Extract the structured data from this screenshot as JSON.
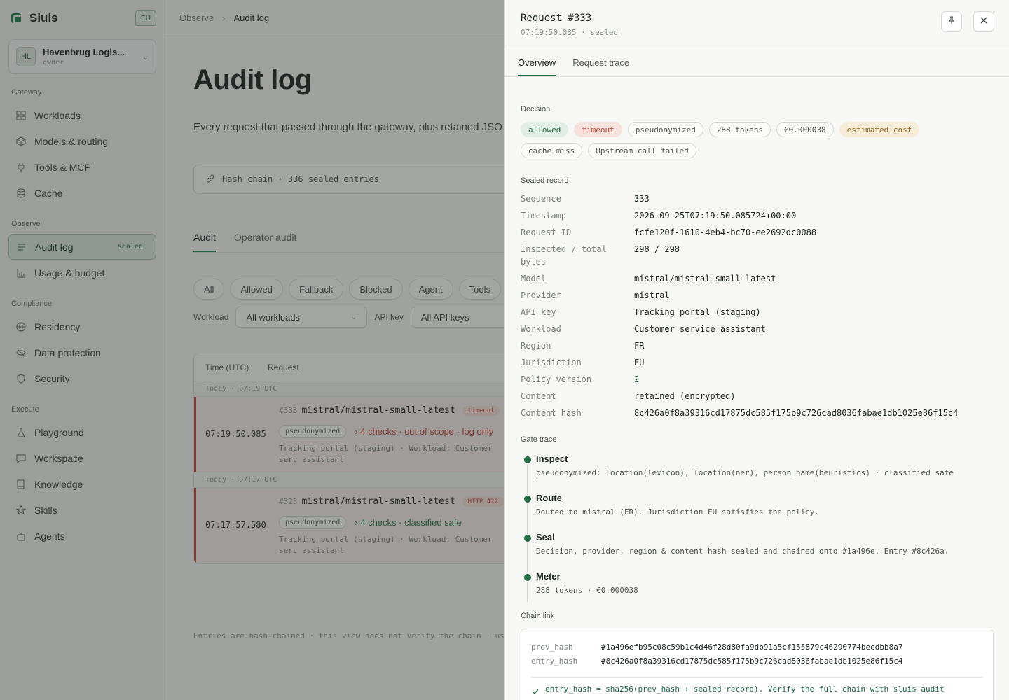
{
  "sidebar": {
    "brand": "Sluis",
    "region": "EU",
    "org": {
      "initials": "HL",
      "name": "Havenbrug Logis...",
      "role": "owner"
    },
    "sections": {
      "gateway": "Gateway",
      "observe": "Observe",
      "compliance": "Compliance",
      "execute": "Execute"
    },
    "items": {
      "workloads": "Workloads",
      "models": "Models & routing",
      "tools": "Tools & MCP",
      "cache": "Cache",
      "audit": "Audit log",
      "audit_badge": "sealed",
      "usage": "Usage & budget",
      "residency": "Residency",
      "data_protection": "Data protection",
      "security": "Security",
      "playground": "Playground",
      "workspace": "Workspace",
      "knowledge": "Knowledge",
      "skills": "Skills",
      "agents": "Agents"
    }
  },
  "breadcrumb": {
    "parent": "Observe",
    "current": "Audit log"
  },
  "page": {
    "title": "Audit log",
    "description": "Every request that passed through the gateway, plus retained JSO",
    "hash_chain": "Hash chain · 336 sealed entries",
    "tabs": [
      "Audit",
      "Operator audit"
    ],
    "filters": [
      "All",
      "Allowed",
      "Fallback",
      "Blocked",
      "Agent",
      "Tools"
    ],
    "workload_label": "Workload",
    "workload_value": "All workloads",
    "apikey_label": "API key",
    "apikey_value": "All API keys",
    "table": {
      "col_time": "Time (UTC)",
      "col_request": "Request",
      "groups": [
        {
          "day": "Today · 07:19 UTC",
          "time": "07:19:50.085",
          "seq": "#333",
          "model": "mistral/mistral-small-latest",
          "tag": "timeout",
          "pill": "pseudonymized",
          "checks": "› 4 checks · out of scope · log only",
          "meta": "Tracking portal (staging) · Workload: Customer serv assistant"
        },
        {
          "day": "Today · 07:17 UTC",
          "time": "07:17:57.580",
          "seq": "#323",
          "model": "mistral/mistral-small-latest",
          "tag": "HTTP 422",
          "pill": "pseudonymized",
          "checks": "› 4 checks · classified safe",
          "meta": "Tracking portal (staging) · Workload: Customer serv assistant"
        }
      ]
    },
    "footer": "Entries are hash-chained · this view does not verify the chain · use"
  },
  "drawer": {
    "title": "Request #333",
    "subtitle": "07:19:50.085 · sealed",
    "tabs": [
      "Overview",
      "Request trace"
    ],
    "decision_label": "Decision",
    "badges": [
      {
        "text": "allowed",
        "kind": "green"
      },
      {
        "text": "timeout",
        "kind": "red"
      },
      {
        "text": "pseudonymized",
        "kind": "plain"
      },
      {
        "text": "288 tokens",
        "kind": "plain"
      },
      {
        "text": "€0.000038",
        "kind": "plain"
      },
      {
        "text": "estimated cost",
        "kind": "amber"
      },
      {
        "text": "cache miss",
        "kind": "plain"
      },
      {
        "text": "Upstream call failed",
        "kind": "plain"
      }
    ],
    "sealed_label": "Sealed record",
    "record": [
      {
        "k": "Sequence",
        "v": "333"
      },
      {
        "k": "Timestamp",
        "v": "2026-09-25T07:19:50.085724+00:00"
      },
      {
        "k": "Request ID",
        "v": "fcfe120f-1610-4eb4-bc70-ee2692dc0088"
      },
      {
        "k": "Inspected / total bytes",
        "v": "298 / 298"
      },
      {
        "k": "Model",
        "v": "mistral/mistral-small-latest"
      },
      {
        "k": "Provider",
        "v": "mistral"
      },
      {
        "k": "API key",
        "v": "Tracking portal (staging)"
      },
      {
        "k": "Workload",
        "v": "Customer service assistant"
      },
      {
        "k": "Region",
        "v": "FR"
      },
      {
        "k": "Jurisdiction",
        "v": "EU"
      },
      {
        "k": "Policy version",
        "v": "2"
      },
      {
        "k": "Content",
        "v": "retained (encrypted)"
      },
      {
        "k": "Content hash",
        "v": "8c426a0f8a39316cd17875dc585f175b9c726cad8036fabae1db1025e86f15c4"
      }
    ],
    "gate_label": "Gate trace",
    "gates": [
      {
        "name": "Inspect",
        "desc": "pseudonymized: location(lexicon), location(ner), person_name(heuristics) · classified safe"
      },
      {
        "name": "Route",
        "desc": "Routed to mistral (FR). Jurisdiction EU satisfies the policy."
      },
      {
        "name": "Seal",
        "desc": "Decision, provider, region & content hash sealed and chained onto #1a496e. Entry #8c426a."
      },
      {
        "name": "Meter",
        "desc": "288 tokens · €0.000038"
      }
    ],
    "chain_label": "Chain link",
    "chain": {
      "prev_k": "prev_hash",
      "prev_v": "#1a496efb95c08c59b1c4d46f28d80fa9db91a5cf155879c46290774beedbb8a7",
      "entry_k": "entry_hash",
      "entry_v": "#8c426a0f8a39316cd17875dc585f175b9c726cad8036fabae1db1025e86f15c4",
      "note": "entry_hash = sha256(prev_hash + sealed record). Verify the full chain with sluis audit"
    }
  },
  "colors": {
    "accent": "#1f7a4a",
    "danger": "#c4463a"
  }
}
